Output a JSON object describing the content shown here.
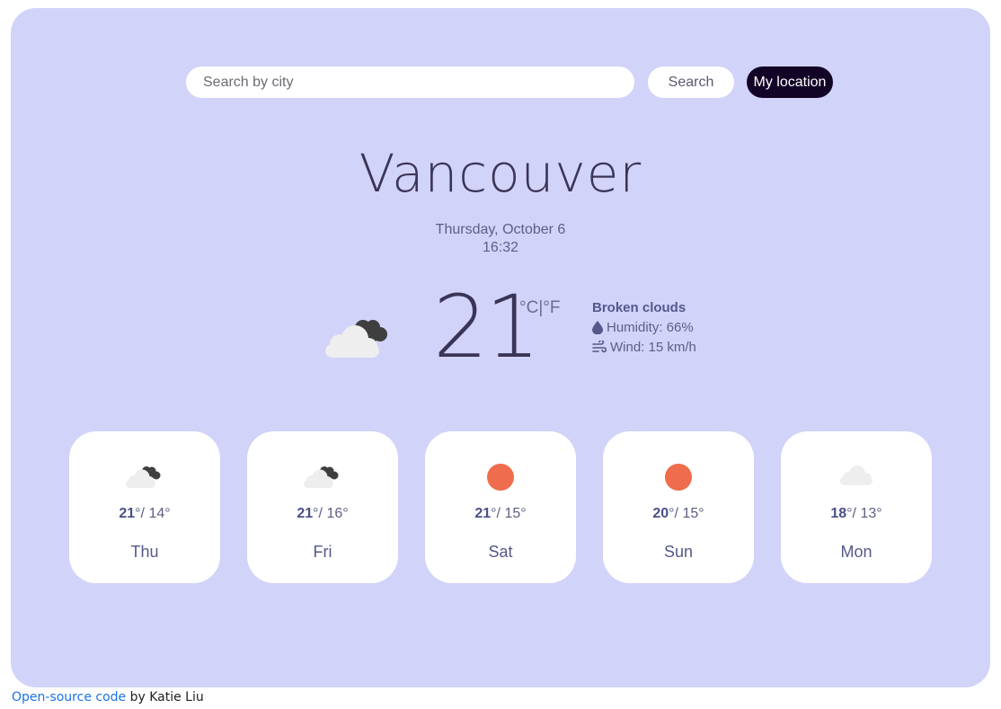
{
  "search": {
    "placeholder": "Search by city",
    "search_label": "Search",
    "location_label": "My location"
  },
  "current": {
    "city": "Vancouver",
    "date": "Thursday, October 6",
    "time": "16:32",
    "temperature": "21",
    "unit_c": "°C",
    "separator": "|",
    "unit_f": "°F",
    "description": "Broken clouds",
    "humidity": "Humidity: 66%",
    "wind": "Wind: 15 km/h",
    "icon": "broken-clouds-icon"
  },
  "forecast": [
    {
      "day": "Thu",
      "max": "21",
      "min": "14",
      "icon": "broken-clouds-icon"
    },
    {
      "day": "Fri",
      "max": "21",
      "min": "16",
      "icon": "broken-clouds-icon"
    },
    {
      "day": "Sat",
      "max": "21",
      "min": "15",
      "icon": "sun-icon"
    },
    {
      "day": "Sun",
      "max": "20",
      "min": "15",
      "icon": "sun-icon"
    },
    {
      "day": "Mon",
      "max": "18",
      "min": "13",
      "icon": "cloud-icon"
    }
  ],
  "degree": "°",
  "min_sep": "/ ",
  "footer": {
    "link_text": "Open-source code",
    "author_text": " by Katie Liu"
  },
  "colors": {
    "background": "#d2d3f9",
    "accent_dark": "#120427",
    "sun": "#ef6c4d",
    "text": "#5d5f82"
  }
}
